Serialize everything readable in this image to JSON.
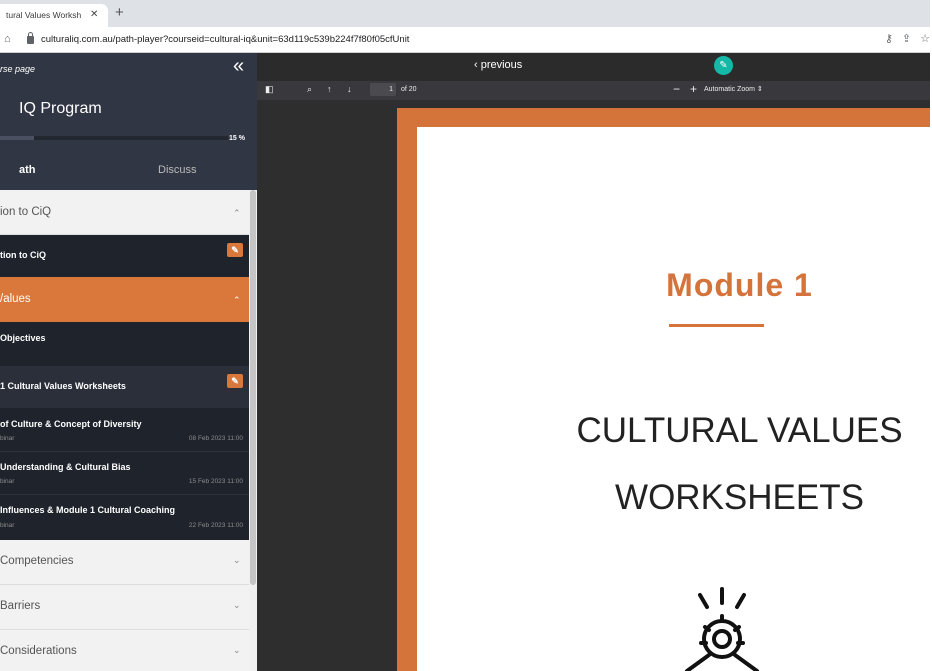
{
  "browser": {
    "tab_title": "tural Values Worksh",
    "tab_close": "✕",
    "new_tab": "+",
    "url": "culturaliq.com.au/path-player?courseid=cultural-iq&unit=63d119c539b224f7f80f05cfUnit"
  },
  "sidebar": {
    "back_label": "rse page",
    "collapse_icon": "«",
    "program_title": "IQ Program",
    "progress_value": 0.15,
    "progress_text": "15 %",
    "tab_path": "ath",
    "tab_discuss": "Discuss",
    "modules": [
      {
        "label": "ion to CiQ",
        "chevron": "⌃",
        "active": false
      },
      {
        "label": "/alues",
        "chevron": "⌃",
        "active": true
      },
      {
        "label": "Competencies",
        "chevron": "⌄",
        "active": false
      },
      {
        "label": "Barriers",
        "chevron": "⌄",
        "active": false
      },
      {
        "label": "Considerations",
        "chevron": "⌄",
        "active": false
      }
    ],
    "items": [
      {
        "label": "tion to CiQ",
        "edit_icon": "✎"
      },
      {
        "label": "Objectives"
      },
      {
        "label": "1 Cultural Values Worksheets",
        "edit_icon": "✎"
      },
      {
        "label": "of Culture & Concept of Diversity",
        "type": "binar",
        "date": "08 Feb 2023 11:00"
      },
      {
        "label": "Understanding & Cultural Bias",
        "type": "binar",
        "date": "15 Feb 2023 11:00"
      },
      {
        "label": "Influences & Module 1 Cultural Coaching",
        "type": "binar",
        "date": "22 Feb 2023 11:00"
      }
    ]
  },
  "viewer": {
    "previous_label": "‹ previous",
    "edit_icon": "✎",
    "page_number": "1",
    "page_of": "of 20",
    "zoom_minus": "−",
    "zoom_plus": "+",
    "zoom_label": "Automatic Zoom"
  },
  "document": {
    "module_title": "Module 1",
    "heading_line1": "CULTURAL VALUES",
    "heading_line2": "WORKSHEETS"
  },
  "colors": {
    "accent": "#d9783a",
    "sidebar_bg": "#2f3542",
    "teal": "#14b8a6"
  }
}
